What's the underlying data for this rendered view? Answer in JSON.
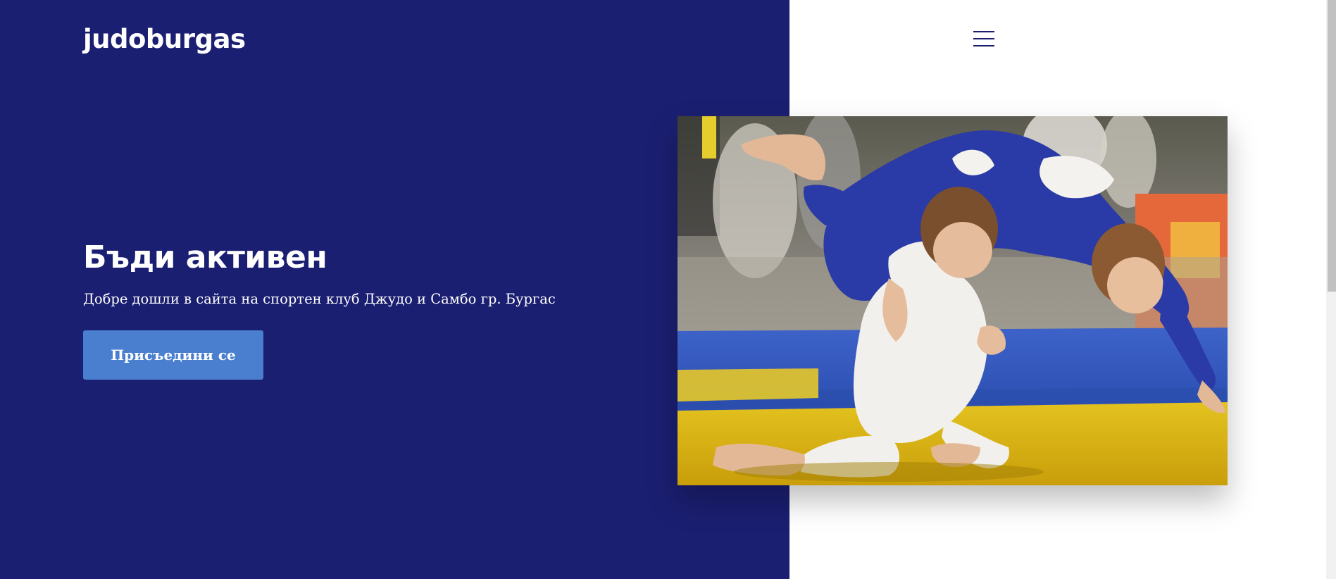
{
  "header": {
    "logo_text": "judoburgas",
    "menu_icon": "hamburger-menu-icon"
  },
  "hero": {
    "title": "Бъди активен",
    "subtitle": "Добре дошли в сайта на спортен клуб Джудо и Самбо гр. Бургас",
    "cta_label": "Присъедини се",
    "image_subject": "two children in judo gis competing on a blue and yellow tatami mat"
  },
  "colors": {
    "primary": "#1b1f71",
    "accent": "#4a7fd0",
    "background": "#ffffff"
  }
}
